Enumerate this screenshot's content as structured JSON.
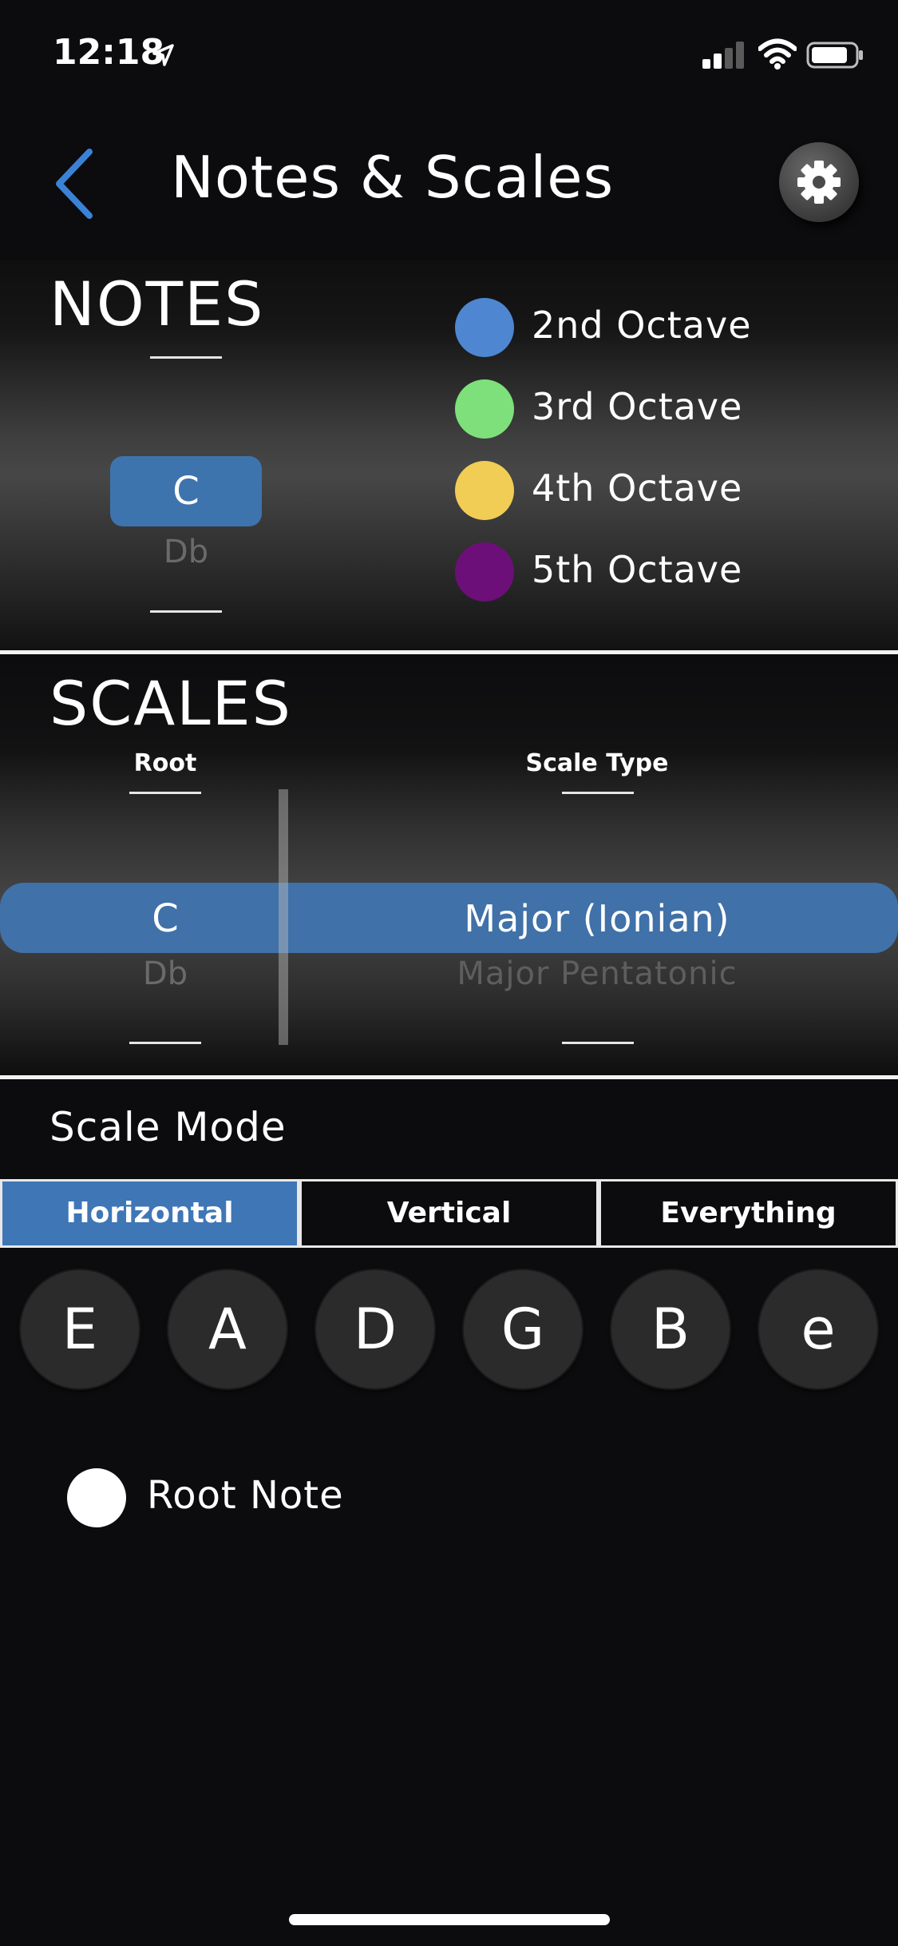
{
  "status_bar": {
    "time": "12:18"
  },
  "nav": {
    "title": "Notes & Scales"
  },
  "notes": {
    "title": "NOTES",
    "picker": {
      "selected": "C",
      "next": "Db"
    },
    "legend": [
      {
        "label": "2nd Octave",
        "color": "#4f86d1"
      },
      {
        "label": "3rd Octave",
        "color": "#7ee07a"
      },
      {
        "label": "4th Octave",
        "color": "#f1cd56"
      },
      {
        "label": "5th Octave",
        "color": "#6c0f78"
      }
    ]
  },
  "scales": {
    "title": "SCALES",
    "root_label": "Root",
    "scale_type_label": "Scale Type",
    "root": {
      "selected": "C",
      "next": "Db"
    },
    "scale_type": {
      "selected": "Major (Ionian)",
      "next": "Major Pentatonic"
    }
  },
  "scale_mode": {
    "label": "Scale Mode",
    "options": [
      "Horizontal",
      "Vertical",
      "Everything"
    ],
    "selected": "Horizontal"
  },
  "strings": [
    "E",
    "A",
    "D",
    "G",
    "B",
    "e"
  ],
  "root_note_legend": {
    "label": "Root Note",
    "color": "#ffffff"
  },
  "colors": {
    "accent": "#3f76b6",
    "back_arrow": "#3b82d6"
  }
}
